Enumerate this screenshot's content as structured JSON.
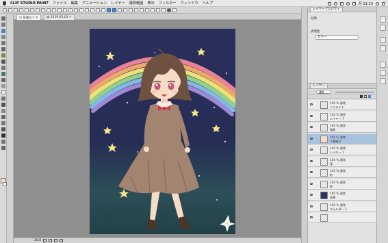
{
  "menubar": {
    "app_name": "CLIP STUDIO PAINT",
    "items": [
      "ファイル",
      "編集",
      "アニメーション",
      "レイヤー",
      "選択範囲",
      "表示",
      "フィルター",
      "ウィンドウ",
      "ヘルプ"
    ],
    "clock": "月 21:23"
  },
  "tabs": [
    {
      "label": "⊡ 花嵐(に? ✕"
    },
    {
      "label": "▤ 2019.03.03 ✕"
    }
  ],
  "property_panel": {
    "tab_label": "レイヤープロパティ",
    "effect_label": "効果",
    "expression_label": "表現色",
    "expression_value": "カラー"
  },
  "layer_panel": {
    "tab_label": "レイヤー",
    "blend_value": "通常",
    "layers": [
      {
        "blend": "100 % 通常",
        "name": "ハイライト"
      },
      {
        "blend": "100 % 通常",
        "name": "レイヤー 7"
      },
      {
        "blend": "100 % 通常",
        "name": "陰影"
      },
      {
        "blend": "100 % 通常",
        "name": "人物塗り",
        "selected": true
      },
      {
        "blend": "100 % 通常",
        "name": "レイヤー 1"
      },
      {
        "blend": "100 % 通常",
        "name": "星"
      },
      {
        "blend": "100 % 通常",
        "name": "虹"
      },
      {
        "blend": "100 % 通常",
        "name": "影"
      },
      {
        "blend": "100 % 通常",
        "name": "背景"
      },
      {
        "blend": "100 % 通常",
        "name": "フォルダー 1"
      },
      {
        "blend": "",
        "name": ""
      }
    ]
  },
  "statusbar": {
    "zoom": "28.8"
  },
  "colors": {
    "sky_top": "#2a2f5c",
    "sky_bottom": "#2c4f57",
    "accent_selection": "#a9c3df",
    "bow": "#d9354c",
    "dress": "#a38470"
  }
}
